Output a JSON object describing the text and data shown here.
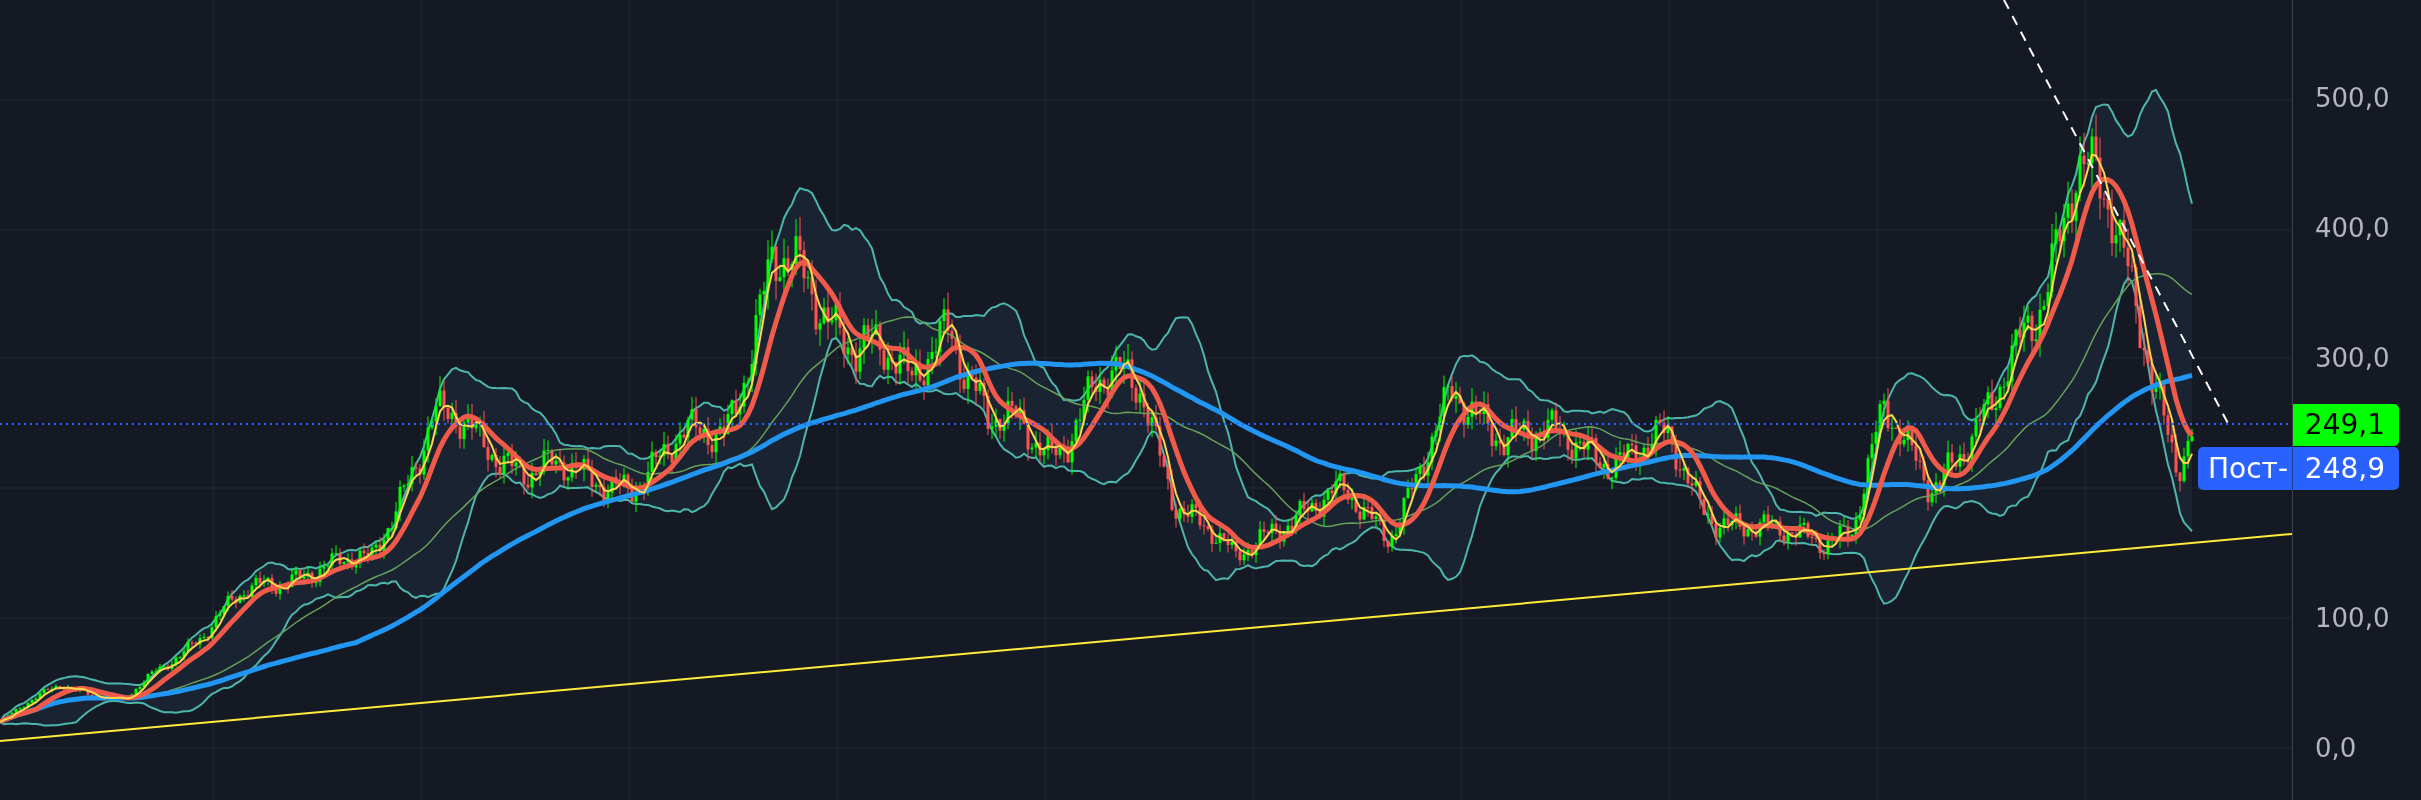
{
  "price_axis": {
    "labels": [
      "500,0",
      "400,0",
      "300,0",
      "100,0",
      "0,0"
    ]
  },
  "price_badges": [
    {
      "kind": "last",
      "value": "249,1",
      "color": "#00ff00"
    },
    {
      "kind": "countdown",
      "label": "Пост-",
      "value": "248,9",
      "color": "#2962ff"
    }
  ]
}
